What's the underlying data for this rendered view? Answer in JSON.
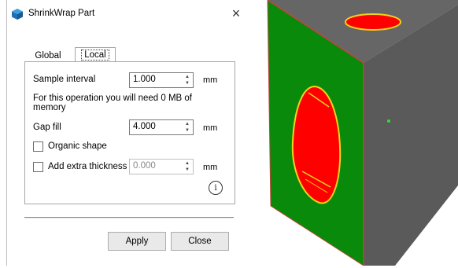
{
  "dialog": {
    "title": "ShrinkWrap Part",
    "close_glyph": "×",
    "tabs": [
      {
        "label": "Global",
        "active": false
      },
      {
        "label": "Local",
        "active": true
      }
    ],
    "sample_interval": {
      "label": "Sample interval",
      "value": "1.000",
      "unit": "mm"
    },
    "memory_note": {
      "line1": "For this operation you will need 0 MB of",
      "line2": "memory"
    },
    "gap_fill": {
      "label": "Gap fill",
      "value": "4.000",
      "unit": "mm"
    },
    "organic_shape": {
      "label": "Organic shape",
      "checked": false
    },
    "extra_thickness": {
      "label": "Add extra thickness",
      "value": "0.000",
      "unit": "mm",
      "checked": false,
      "enabled": false
    },
    "info_glyph": "i",
    "buttons": {
      "apply": "Apply",
      "close": "Close"
    }
  },
  "colors": {
    "accent_red": "#ff0000",
    "face_green": "#0a8a0a",
    "face_gray": "#595959",
    "edge_yellow": "#f2d21c"
  },
  "icons": [
    "part-icon",
    "close-icon",
    "info-icon",
    "spin-arrows-icon"
  ]
}
